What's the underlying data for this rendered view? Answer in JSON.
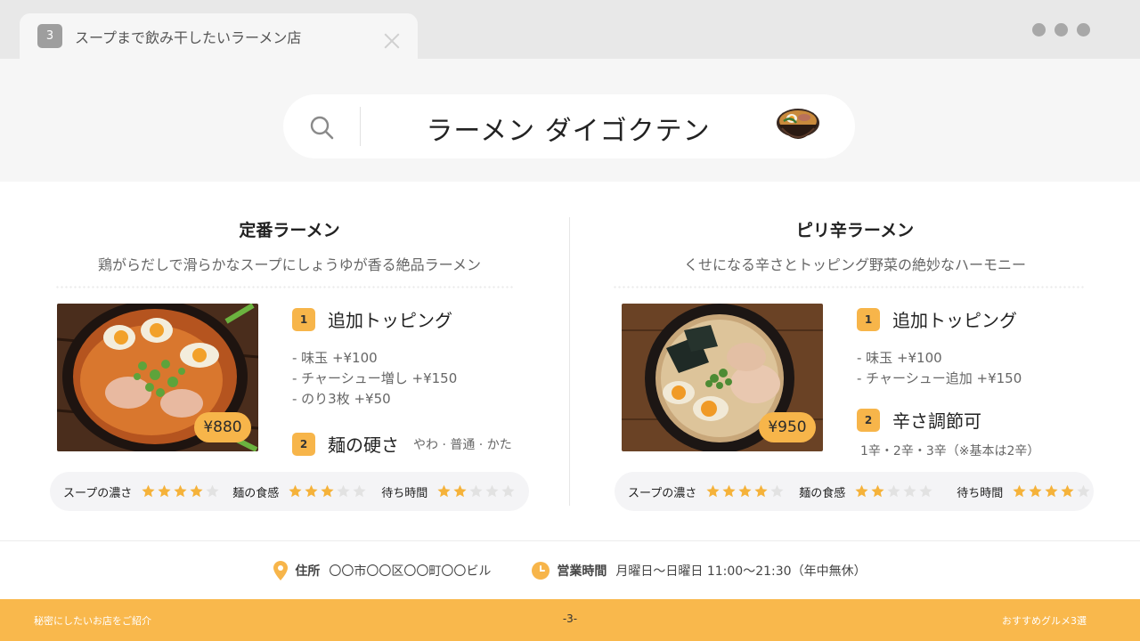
{
  "tab": {
    "number": "3",
    "title": "スープまで飲み干したいラーメン店"
  },
  "search": {
    "query": "ラーメン ダイゴクテン"
  },
  "colors": {
    "accent": "#f7b54a",
    "star_filled": "#f5b23a",
    "star_empty": "#e2e2e2"
  },
  "left": {
    "title": "定番ラーメン",
    "subtitle": "鶏がらだしで滑らかなスープにしょうゆが香る絶品ラーメン",
    "price": "¥880",
    "section1": {
      "num": "1",
      "heading": "追加トッピング",
      "items": [
        "- 味玉 +¥100",
        "- チャーシュー増し +¥150",
        "- のり3枚 +¥50"
      ]
    },
    "section2": {
      "num": "2",
      "heading": "麺の硬さ",
      "note": "やわ · 普通 · かた"
    },
    "ratings": [
      {
        "label": "スープの濃さ",
        "stars": 4
      },
      {
        "label": "麺の食感",
        "stars": 3
      },
      {
        "label": "待ち時間",
        "stars": 2
      }
    ]
  },
  "right": {
    "title": "ピリ辛ラーメン",
    "subtitle": "くせになる辛さとトッピング野菜の絶妙なハーモニー",
    "price": "¥950",
    "section1": {
      "num": "1",
      "heading": "追加トッピング",
      "items": [
        "- 味玉 +¥100",
        "- チャーシュー追加 +¥150"
      ]
    },
    "section2": {
      "num": "2",
      "heading": "辛さ調節可",
      "note": "1辛・2辛・3辛（※基本は2辛）"
    },
    "ratings": [
      {
        "label": "スープの濃さ",
        "stars": 4
      },
      {
        "label": "麺の食感",
        "stars": 2
      },
      {
        "label": "待ち時間",
        "stars": 4
      }
    ]
  },
  "footer": {
    "address_label": "住所",
    "address": "〇〇市〇〇区〇〇町〇〇ビル",
    "hours_label": "営業時間",
    "hours": "月曜日～日曜日 11:00～21:30（年中無休）"
  },
  "bottom": {
    "left": "秘密にしたいお店をご紹介",
    "page": "-3-",
    "right": "おすすめグルメ3選"
  }
}
